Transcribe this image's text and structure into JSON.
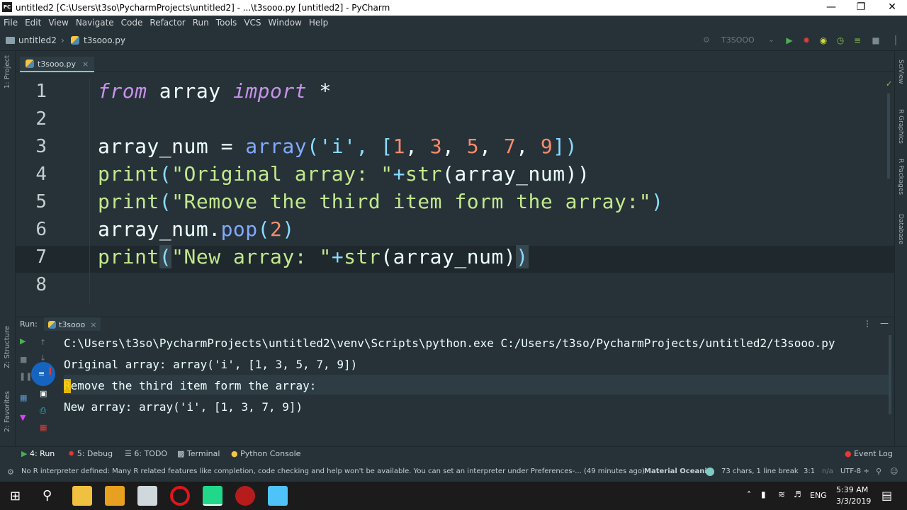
{
  "window": {
    "title": "untitled2 [C:\\Users\\t3so\\PycharmProjects\\untitled2] - ...\\t3sooo.py [untitled2] - PyCharm",
    "app_icon": "PC"
  },
  "menu": [
    "File",
    "Edit",
    "View",
    "Navigate",
    "Code",
    "Refactor",
    "Run",
    "Tools",
    "VCS",
    "Window",
    "Help"
  ],
  "breadcrumb": {
    "project": "untitled2",
    "file": "t3sooo.py"
  },
  "run_config": "T3SOOO",
  "left_strip": {
    "project": "1: Project",
    "structure": "Z: Structure",
    "favorites": "2: Favorites"
  },
  "right_strip": [
    "SciView",
    "R Graphics",
    "R Packages",
    "Database"
  ],
  "editor_tab": "t3sooo.py",
  "line_numbers": [
    "1",
    "2",
    "3",
    "4",
    "5",
    "6",
    "7",
    "8"
  ],
  "code": {
    "l1_from": "from",
    "l1_mod": " array ",
    "l1_import": "import",
    "l1_star": " *",
    "l3_a": "array_num = ",
    "l3_b": "array",
    "l3_c": "('i', [",
    "l3_n1": "1",
    "l3_s1": ", ",
    "l3_n2": "3",
    "l3_s2": ", ",
    "l3_n3": "5",
    "l3_s3": ", ",
    "l3_n4": "7",
    "l3_s4": ", ",
    "l3_n5": "9",
    "l3_end": "])",
    "l4_a": "print",
    "l4_b": "(",
    "l4_c": "\"Original array: \"",
    "l4_d": "+",
    "l4_e": "str",
    "l4_f": "(array_num))",
    "l5_a": "print",
    "l5_b": "(",
    "l5_c": "\"Remove the third item form the array:\"",
    "l5_d": ")",
    "l6_a": "array_num.",
    "l6_b": "pop",
    "l6_c": "(",
    "l6_d": "2",
    "l6_e": ")",
    "l7_a": "print",
    "l7_b": "(",
    "l7_c": "\"New array: \"",
    "l7_d": "+",
    "l7_e": "str",
    "l7_f": "(array_num)",
    "l7_g": ")"
  },
  "run_panel": {
    "label": "Run:",
    "tab": "t3sooo",
    "output": [
      "C:\\Users\\t3so\\PycharmProjects\\untitled2\\venv\\Scripts\\python.exe C:/Users/t3so/PycharmProjects/untitled2/t3sooo.py",
      "Original array: array('i', [1, 3, 5, 7, 9])",
      "Remove the third item form the array:",
      "New array: array('i', [1, 3, 7, 9])"
    ]
  },
  "tool_windows": {
    "run": "4: Run",
    "debug": "5: Debug",
    "todo": "6: TODO",
    "terminal": "Terminal",
    "python_console": "Python Console",
    "event_log": "Event Log"
  },
  "status": {
    "message": "No R interpreter defined: Many R related features like completion, code checking and help won't be available. You can set an interpreter under Preferences-... (49 minutes ago)",
    "theme": "Material Oceanic",
    "chars": "73 chars, 1 line break",
    "position": "3:1",
    "na": "n/a",
    "encoding": "UTF-8 ÷"
  },
  "taskbar": {
    "lang": "ENG",
    "time": "5:39 AM",
    "date": "3/3/2019"
  },
  "colors": {
    "bg": "#263238",
    "keyword": "#c792ea",
    "string": "#c3e88d",
    "number": "#f78c6c",
    "function": "#82aaff",
    "accent": "#80cbc4"
  }
}
